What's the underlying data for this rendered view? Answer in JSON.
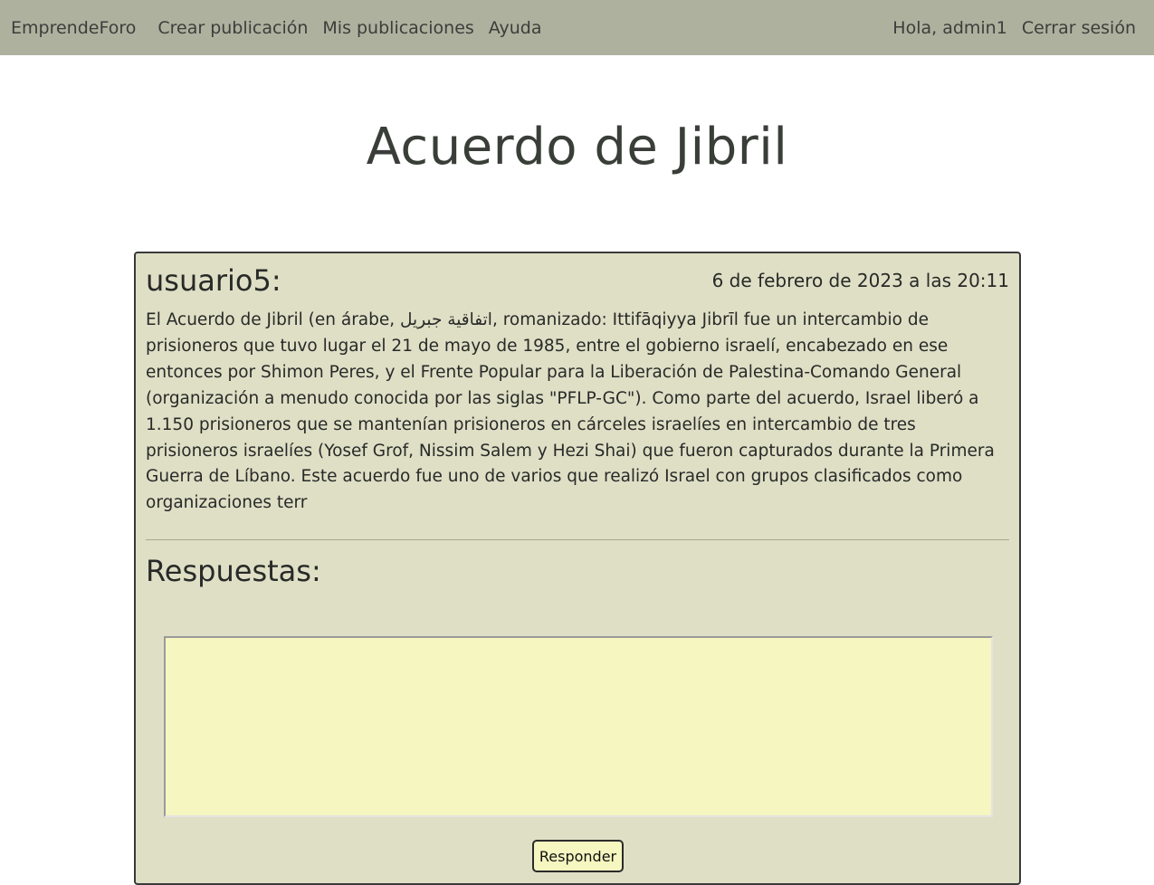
{
  "nav": {
    "brand": "EmprendeForo",
    "create_post": "Crear publicación",
    "my_posts": "Mis publicaciones",
    "help": "Ayuda",
    "greeting": "Hola, admin1",
    "logout": "Cerrar sesión"
  },
  "post": {
    "title": "Acuerdo de Jibril",
    "author": "usuario5:",
    "date": "6 de febrero de 2023 a las 20:11",
    "body": "El Acuerdo de Jibril (en árabe, اتفاقية جبريل, romanizado: Ittifāqiyya Jibrīl fue un intercambio de prisioneros que tuvo lugar el 21 de mayo de 1985, entre el gobierno israelí, encabezado en ese entonces por Shimon Peres, y el Frente Popular para la Liberación de Palestina-Comando General (organización a menudo conocida por las siglas \"PFLP-GC\"). Como parte del acuerdo, Israel liberó a 1.150 prisioneros que se mantenían prisioneros en cárceles israelíes en intercambio de tres prisioneros israelíes (Yosef Grof, Nissim Salem y Hezi Shai) que fueron capturados durante la Primera Guerra de Líbano. Este acuerdo fue uno de varios que realizó Israel con grupos clasificados como organizaciones terr"
  },
  "replies": {
    "title": "Respuestas:",
    "textarea_value": "",
    "button_label": "Responder"
  },
  "colors": {
    "navbar": "#afb19f",
    "card": "#dfdfc6",
    "input": "#f5f6c0"
  }
}
